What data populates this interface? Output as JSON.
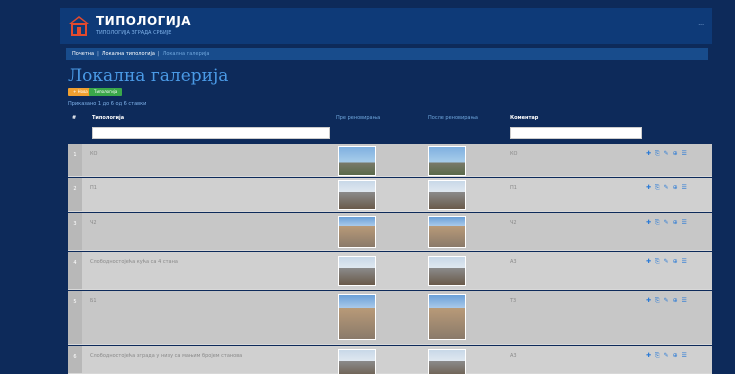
{
  "header": {
    "brand_title": "ТИПОЛОГИЈА",
    "brand_subtitle": "ТИПОЛОГИЈА ЗГРАДА СРБИЈЕ",
    "menu": "···"
  },
  "breadcrumb": {
    "home": "Почетна",
    "section": "Локална типологија",
    "current": "Локална галерија"
  },
  "page": {
    "title": "Локална галерија",
    "btn_orange": "+ Нова",
    "btn_green": "Типологија",
    "count_text": "Приказано 1 до 6 од 6 ставки"
  },
  "table": {
    "headers": {
      "idx": "#",
      "typology": "Типологија",
      "before": "Пре реновирања",
      "after": "После реновирања",
      "comment": "Коментар"
    },
    "rows": [
      {
        "idx": "1",
        "name": "КО",
        "comment": "КО",
        "actions": "✚ ⎘ ✎ ⊕ ☰"
      },
      {
        "idx": "2",
        "name": "П1",
        "comment": "П1",
        "actions": "✚ ⎘ ✎ ⊕ ☰"
      },
      {
        "idx": "3",
        "name": "Ч2",
        "comment": "Ч2",
        "actions": "✚ ⎘ ✎ ⊕ ☰"
      },
      {
        "idx": "4",
        "name": "Слободностојећа кућа са 4 стана",
        "comment": "А3",
        "actions": "✚ ⎘ ✎ ⊕ ☰"
      },
      {
        "idx": "5",
        "name": "Б1",
        "comment": "Т3",
        "actions": "✚ ⎘ ✎ ⊕ ☰"
      },
      {
        "idx": "6",
        "name": "Слободностојећа зграда у низу са мањим бројем станова",
        "comment": "А3",
        "actions": "✚ ⎘ ✎ ⊕ ☰"
      }
    ]
  },
  "colors": {
    "background": "#0d2a5a",
    "accent": "#4a9ae6",
    "orange": "#f0a030",
    "green": "#3aa84a"
  }
}
